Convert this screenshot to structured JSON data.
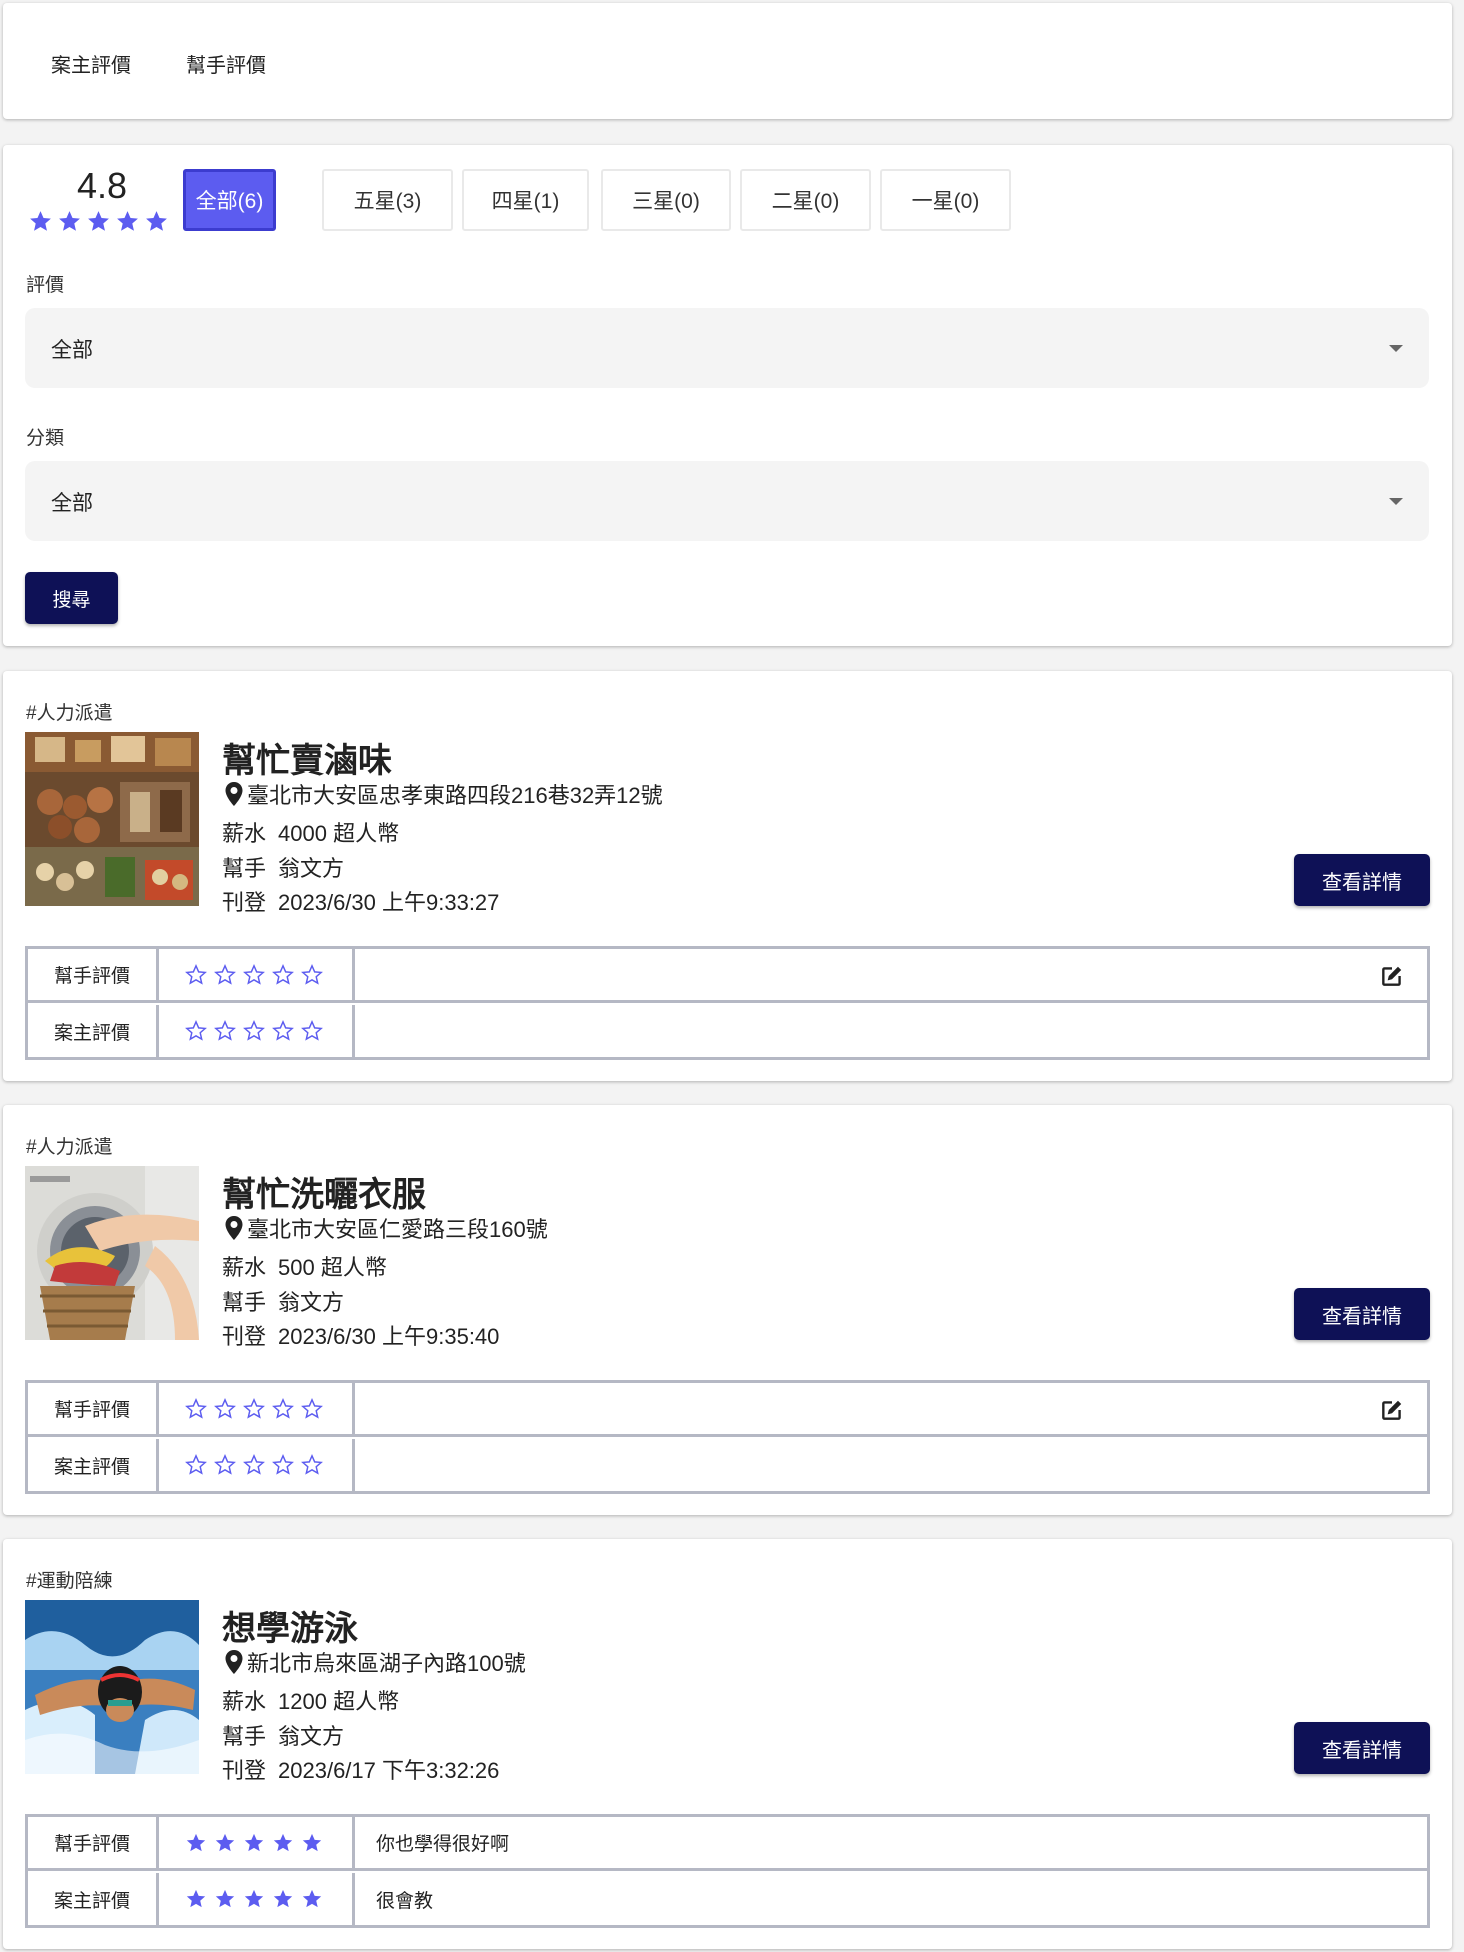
{
  "tabs": [
    {
      "label": "案主評價"
    },
    {
      "label": "幫手評價"
    }
  ],
  "summary": {
    "average": "4.8",
    "average_stars": 4.8,
    "filters": [
      {
        "label": "全部(6)",
        "active": true
      },
      {
        "label": "五星(3)",
        "active": false
      },
      {
        "label": "四星(1)",
        "active": false
      },
      {
        "label": "三星(0)",
        "active": false
      },
      {
        "label": "二星(0)",
        "active": false
      },
      {
        "label": "一星(0)",
        "active": false
      }
    ]
  },
  "form": {
    "rating_label": "評價",
    "rating_value": "全部",
    "category_label": "分類",
    "category_value": "全部",
    "search_label": "搜尋"
  },
  "colors": {
    "accent": "#5c5cf0",
    "primary_button": "#0e1156",
    "table_border": "#b5b8c4"
  },
  "jobs": [
    {
      "tag": "#人力派遣",
      "title": "幫忙賣滷味",
      "address": "臺北市大安區忠孝東路四段216巷32弄12號",
      "salary_key": "薪水",
      "salary": "4000 超人幣",
      "helper_key": "幫手",
      "helper": "翁文方",
      "posted_key": "刊登",
      "posted": "2023/6/30 上午9:33:27",
      "detail_label": "查看詳情",
      "image_icon": "braised-food-photo",
      "ratings": [
        {
          "label": "幫手評價",
          "stars": 0,
          "comment": "",
          "editable": true
        },
        {
          "label": "案主評價",
          "stars": 0,
          "comment": "",
          "editable": false
        }
      ]
    },
    {
      "tag": "#人力派遣",
      "title": "幫忙洗曬衣服",
      "address": "臺北市大安區仁愛路三段160號",
      "salary_key": "薪水",
      "salary": "500 超人幣",
      "helper_key": "幫手",
      "helper": "翁文方",
      "posted_key": "刊登",
      "posted": "2023/6/30 上午9:35:40",
      "detail_label": "查看詳情",
      "image_icon": "laundry-photo",
      "ratings": [
        {
          "label": "幫手評價",
          "stars": 0,
          "comment": "",
          "editable": true
        },
        {
          "label": "案主評價",
          "stars": 0,
          "comment": "",
          "editable": false
        }
      ]
    },
    {
      "tag": "#運動陪練",
      "title": "想學游泳",
      "address": "新北市烏來區湖子內路100號",
      "salary_key": "薪水",
      "salary": "1200 超人幣",
      "helper_key": "幫手",
      "helper": "翁文方",
      "posted_key": "刊登",
      "posted": "2023/6/17 下午3:32:26",
      "detail_label": "查看詳情",
      "image_icon": "swimmer-photo",
      "ratings": [
        {
          "label": "幫手評價",
          "stars": 5,
          "comment": "你也學得很好啊",
          "editable": false
        },
        {
          "label": "案主評價",
          "stars": 5,
          "comment": "很會教",
          "editable": false
        }
      ]
    }
  ]
}
